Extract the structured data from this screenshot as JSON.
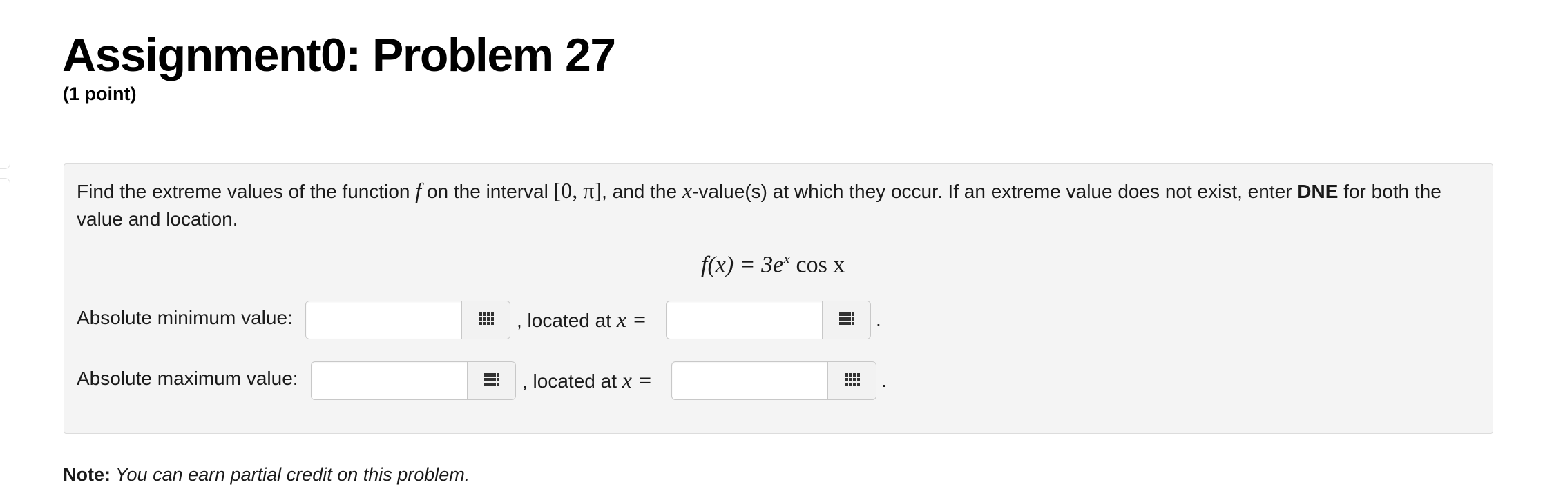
{
  "header": {
    "title": "Assignment0: Problem 27",
    "points": "(1 point)"
  },
  "problem": {
    "prompt_part1": "Find the extreme values of the function ",
    "func_symbol": "f",
    "prompt_part2": " on the interval ",
    "interval": "[0, π]",
    "prompt_part3": ", and the ",
    "x_symbol": "x",
    "prompt_part4": "-value(s) at which they occur. If an extreme value does not exist, enter ",
    "dne": "DNE",
    "prompt_part5": " for both the value and location.",
    "equation_lhs": "f(x) = 3e",
    "equation_exp": "x",
    "equation_rhs": " cos x"
  },
  "answers": {
    "min_label": "Absolute minimum value:",
    "max_label": "Absolute maximum value:",
    "located_at": ", located at ",
    "x_equals": "x =",
    "period": ".",
    "min_value": "",
    "min_location": "",
    "max_value": "",
    "max_location": ""
  },
  "footer": {
    "note_label": "Note:",
    "note_text": " You can earn partial credit on this problem."
  },
  "icons": {
    "palette_button": "grid-icon"
  }
}
